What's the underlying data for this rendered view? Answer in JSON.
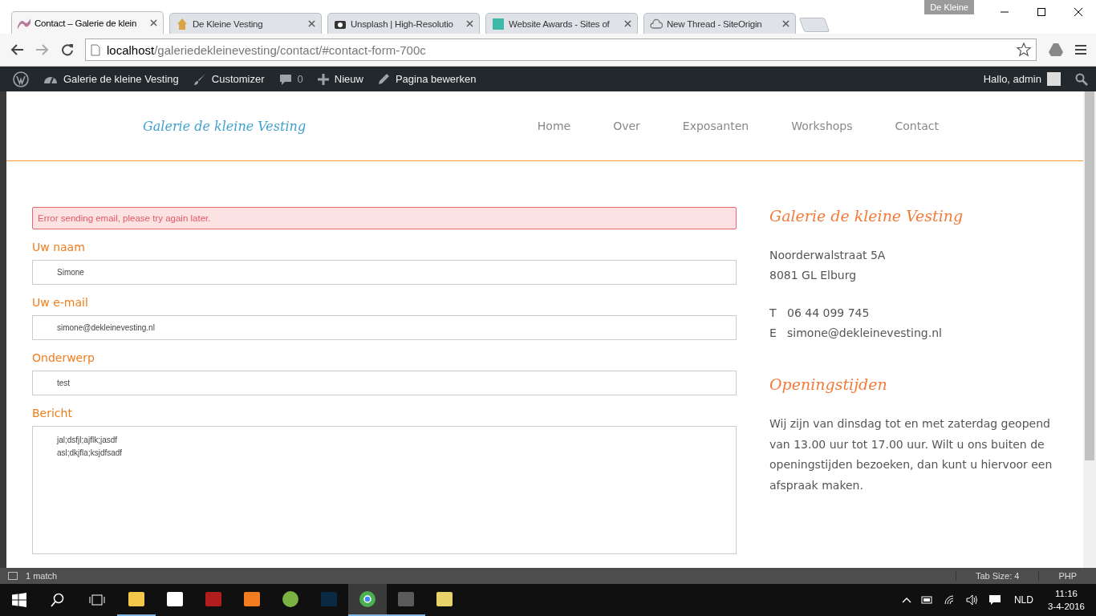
{
  "browser": {
    "profile": "De Kleine",
    "tabs": [
      {
        "title": "Contact – Galerie de klein",
        "kind": "logo",
        "selected": true
      },
      {
        "title": "De Kleine Vesting",
        "kind": "house",
        "selected": false
      },
      {
        "title": "Unsplash | High-Resolutio",
        "kind": "camera",
        "selected": false
      },
      {
        "title": "Website Awards - Sites of",
        "kind": "square",
        "selected": false
      },
      {
        "title": "New Thread - SiteOrigin",
        "kind": "cloud",
        "selected": false
      }
    ],
    "url_host": "localhost",
    "url_path": "/galeriedekleinevesting/contact/#contact-form-700c"
  },
  "admin_bar": {
    "site": "Galerie de kleine Vesting",
    "customizer": "Customizer",
    "comments": "0",
    "new": "Nieuw",
    "edit": "Pagina bewerken",
    "greeting": "Hallo, admin"
  },
  "site": {
    "logo": "Galerie de kleine Vesting",
    "nav": [
      "Home",
      "Over",
      "Exposanten",
      "Workshops",
      "Contact"
    ]
  },
  "form": {
    "error": "Error sending email, please try again later.",
    "fields": [
      {
        "label": "Uw naam",
        "kind": "input",
        "value": "Simone"
      },
      {
        "label": "Uw e-mail",
        "kind": "input",
        "value": "simone@dekleinevesting.nl"
      },
      {
        "label": "Onderwerp",
        "kind": "input",
        "value": "test"
      },
      {
        "label": "Bericht",
        "kind": "textarea",
        "lines": [
          "jal;dsfjl;ajflk;jasdf",
          "asl;dkjfla;ksjdfsadf"
        ]
      }
    ]
  },
  "sidebar": {
    "title": "Galerie de kleine Vesting",
    "address": [
      "Noorderwalstraat 5A",
      "8081 GL Elburg"
    ],
    "contacts": [
      {
        "key": "T",
        "value": "06 44 099 745"
      },
      {
        "key": "E",
        "value": "simone@dekleinevesting.nl"
      }
    ],
    "hours_title": "Openingstijden",
    "hours_text": "Wij zijn van dinsdag tot en met zaterdag geopend van 13.00 uur tot 17.00 uur. Wilt u ons buiten de openingstijden bezoeken, dan kunt u hiervoor een afspraak maken."
  },
  "editor_status": {
    "find": "1 match",
    "tab_size": "Tab Size: 4",
    "syntax": "PHP"
  },
  "taskbar": {
    "apps": [
      {
        "kind": "explorer",
        "running": true,
        "selected": false
      },
      {
        "kind": "store",
        "running": false,
        "selected": false
      },
      {
        "kind": "filezilla",
        "running": false,
        "selected": false
      },
      {
        "kind": "xampp",
        "running": false,
        "selected": false
      },
      {
        "kind": "heidisql",
        "running": false,
        "selected": false
      },
      {
        "kind": "photoshop",
        "running": false,
        "selected": false
      },
      {
        "kind": "chrome",
        "running": true,
        "selected": true
      },
      {
        "kind": "sublime",
        "running": true,
        "selected": false
      },
      {
        "kind": "folder",
        "running": false,
        "selected": false
      }
    ],
    "language": "NLD",
    "time": "11:16",
    "date": "3-4-2016"
  }
}
